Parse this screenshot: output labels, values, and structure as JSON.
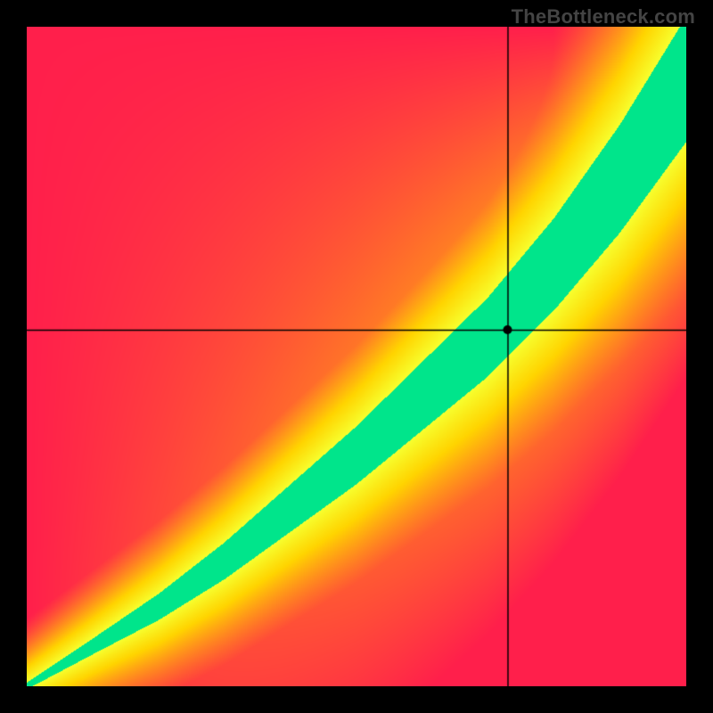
{
  "attribution": "TheBottleneck.com",
  "chart_data": {
    "type": "heatmap",
    "title": "",
    "xlabel": "",
    "ylabel": "",
    "xlim": [
      0,
      1
    ],
    "ylim": [
      0,
      1
    ],
    "crosshair": {
      "x": 0.73,
      "y": 0.54
    },
    "marker": {
      "x": 0.73,
      "y": 0.54
    },
    "optimal_band": {
      "description": "Green band where y is close to the optimal curve f(x); fit degrades to yellow then red with distance.",
      "curve_samples_x": [
        0.0,
        0.1,
        0.2,
        0.3,
        0.4,
        0.5,
        0.6,
        0.7,
        0.8,
        0.9,
        1.0
      ],
      "curve_samples_y": [
        0.0,
        0.06,
        0.12,
        0.19,
        0.27,
        0.35,
        0.44,
        0.53,
        0.64,
        0.77,
        0.92
      ],
      "green_halfwidth_at_x": [
        0.005,
        0.012,
        0.02,
        0.028,
        0.036,
        0.044,
        0.052,
        0.06,
        0.07,
        0.082,
        0.095
      ]
    },
    "color_scale": {
      "stops": [
        {
          "fit": 0.0,
          "color": "#ff1f4b",
          "meaning": "worst"
        },
        {
          "fit": 0.55,
          "color": "#ffd400",
          "meaning": "mid"
        },
        {
          "fit": 0.8,
          "color": "#f7ff2e",
          "meaning": "near"
        },
        {
          "fit": 1.0,
          "color": "#00e58b",
          "meaning": "optimal"
        }
      ]
    }
  }
}
